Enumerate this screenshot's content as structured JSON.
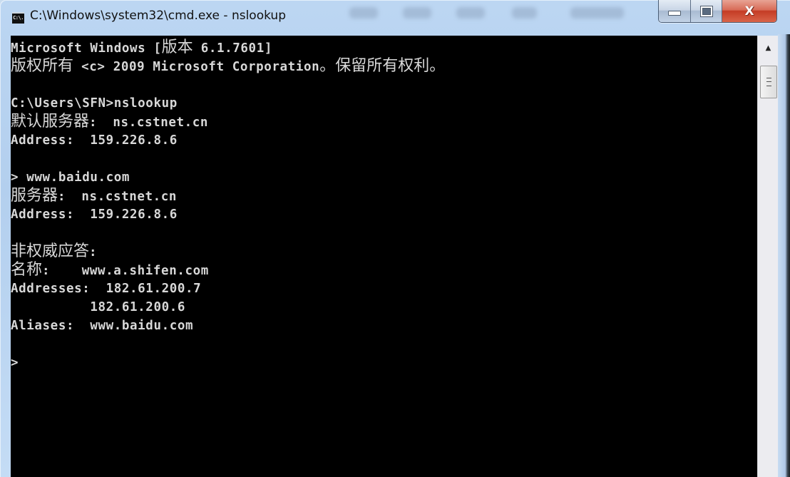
{
  "window": {
    "title": "C:\\Windows\\system32\\cmd.exe - nslookup",
    "icon_label": "C:\\.",
    "icon": "cmd-icon",
    "controls": {
      "minimize_icon": "minimize-icon",
      "maximize_icon": "maximize-icon",
      "close_label": "X"
    }
  },
  "console": {
    "lines": [
      {
        "segments": [
          {
            "t": "Microsoft Windows [",
            "cjk": false
          },
          {
            "t": "版本",
            "cjk": true
          },
          {
            "t": " 6.1.7601]",
            "cjk": false
          }
        ]
      },
      {
        "segments": [
          {
            "t": "版权所有",
            "cjk": true
          },
          {
            "t": " <c> 2009 Microsoft Corporation",
            "cjk": false
          },
          {
            "t": "。保留所有权利。",
            "cjk": true
          }
        ]
      },
      {
        "segments": []
      },
      {
        "segments": [
          {
            "t": "C:\\Users\\SFN>nslookup",
            "cjk": false
          }
        ]
      },
      {
        "segments": [
          {
            "t": "默认服务器",
            "cjk": true
          },
          {
            "t": ":  ns.cstnet.cn",
            "cjk": false
          }
        ]
      },
      {
        "segments": [
          {
            "t": "Address:  159.226.8.6",
            "cjk": false
          }
        ]
      },
      {
        "segments": []
      },
      {
        "segments": [
          {
            "t": "> www.baidu.com",
            "cjk": false
          }
        ]
      },
      {
        "segments": [
          {
            "t": "服务器",
            "cjk": true
          },
          {
            "t": ":  ns.cstnet.cn",
            "cjk": false
          }
        ]
      },
      {
        "segments": [
          {
            "t": "Address:  159.226.8.6",
            "cjk": false
          }
        ]
      },
      {
        "segments": []
      },
      {
        "segments": [
          {
            "t": "非权威应答",
            "cjk": true
          },
          {
            "t": ":",
            "cjk": false
          }
        ]
      },
      {
        "segments": [
          {
            "t": "名称",
            "cjk": true
          },
          {
            "t": ":    www.a.shifen.com",
            "cjk": false
          }
        ]
      },
      {
        "segments": [
          {
            "t": "Addresses:  182.61.200.7",
            "cjk": false
          }
        ]
      },
      {
        "segments": [
          {
            "t": "          182.61.200.6",
            "cjk": false
          }
        ]
      },
      {
        "segments": [
          {
            "t": "Aliases:  www.baidu.com",
            "cjk": false
          }
        ]
      },
      {
        "segments": []
      },
      {
        "segments": [
          {
            "t": ">",
            "cjk": false
          }
        ]
      }
    ]
  },
  "scrollbar": {
    "up_arrow": "▲",
    "position": "top"
  },
  "colors": {
    "console_bg": "#000000",
    "console_fg": "#d8d8d8",
    "close_button": "#c43c25"
  }
}
